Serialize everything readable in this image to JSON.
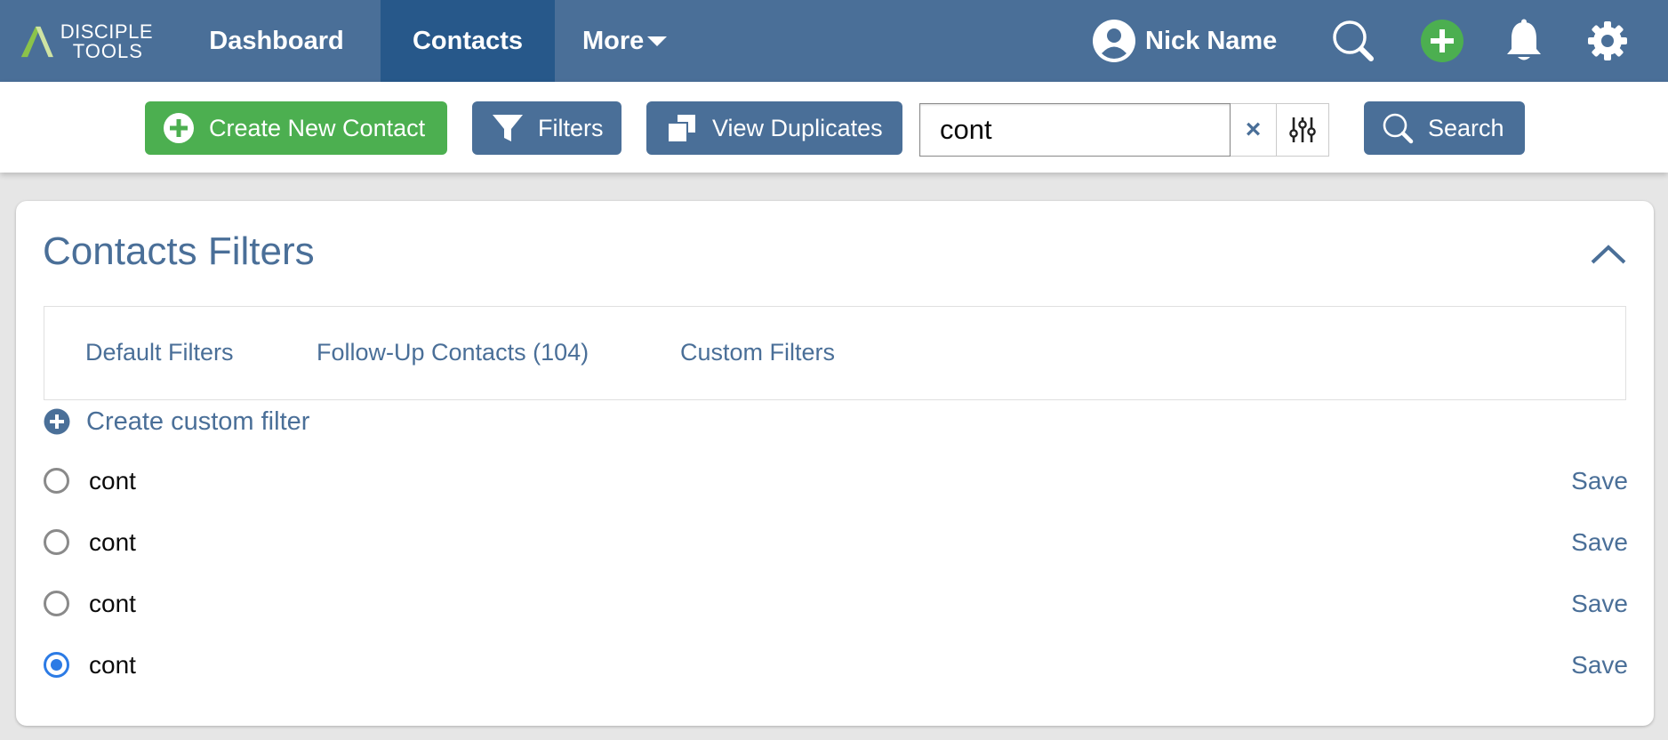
{
  "colors": {
    "nav_bg": "#4a6f98",
    "nav_active_bg": "#27588a",
    "primary": "#4a6f98",
    "success": "#4caf50",
    "radio_checked": "#2c7be5"
  },
  "logo": {
    "line1": "DISCIPLE",
    "line2": "TOOLS"
  },
  "nav": {
    "dashboard": "Dashboard",
    "contacts": "Contacts",
    "more": "More"
  },
  "user": {
    "name": "Nick Name",
    "icon": "user-avatar-icon"
  },
  "top_icons": [
    "search-icon",
    "add-icon",
    "bell-icon",
    "gear-icon"
  ],
  "toolbar": {
    "create_label": "Create New Contact",
    "filters_label": "Filters",
    "duplicates_label": "View Duplicates",
    "search_value": "cont",
    "clear_symbol": "×",
    "search_label": "Search"
  },
  "filters_panel": {
    "title": "Contacts Filters",
    "tabs": [
      {
        "label": "Default Filters"
      },
      {
        "label": "Follow-Up Contacts (104)"
      },
      {
        "label": "Custom Filters"
      }
    ],
    "create_label": "Create custom filter",
    "items": [
      {
        "label": "cont",
        "save": "Save",
        "checked": false
      },
      {
        "label": "cont",
        "save": "Save",
        "checked": false
      },
      {
        "label": "cont",
        "save": "Save",
        "checked": false
      },
      {
        "label": "cont",
        "save": "Save",
        "checked": true
      }
    ]
  }
}
